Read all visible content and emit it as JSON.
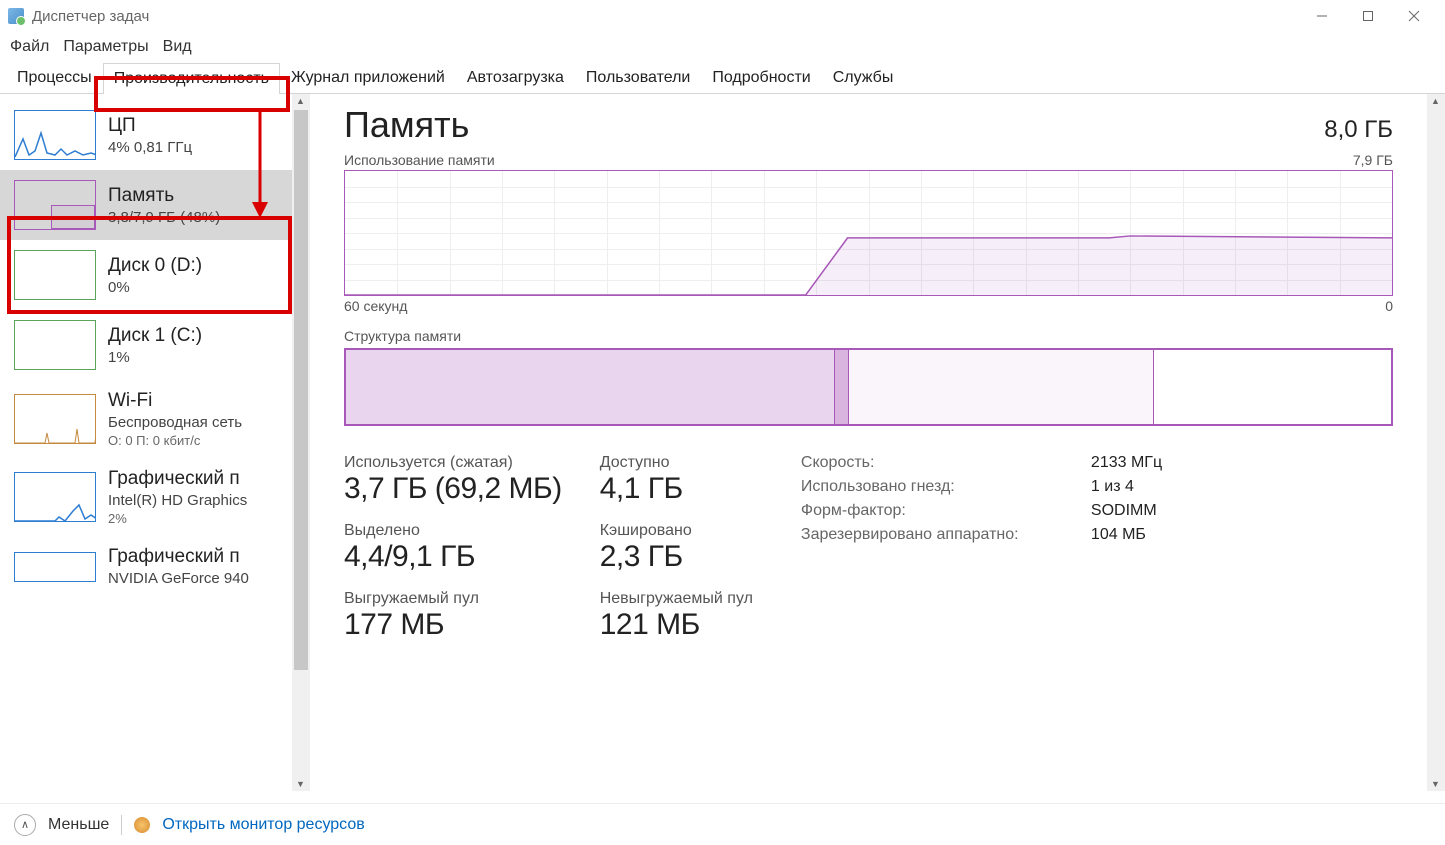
{
  "title": "Диспетчер задач",
  "menu": {
    "file": "Файл",
    "options": "Параметры",
    "view": "Вид"
  },
  "tabs": {
    "processes": "Процессы",
    "performance": "Производительность",
    "app_history": "Журнал приложений",
    "startup": "Автозагрузка",
    "users": "Пользователи",
    "details": "Подробности",
    "services": "Службы"
  },
  "sidebar": {
    "cpu": {
      "title": "ЦП",
      "sub": "4%  0,81 ГГц"
    },
    "memory": {
      "title": "Память",
      "sub": "3,8/7,9 ГБ (48%)"
    },
    "disk0": {
      "title": "Диск 0 (D:)",
      "sub": "0%"
    },
    "disk1": {
      "title": "Диск 1 (C:)",
      "sub": "1%"
    },
    "wifi": {
      "title": "Wi-Fi",
      "sub": "Беспроводная сеть",
      "sub2": "О: 0 П: 0 кбит/с"
    },
    "gpu0": {
      "title": "Графический п",
      "sub": "Intel(R) HD Graphics",
      "sub2": "2%"
    },
    "gpu1": {
      "title": "Графический п",
      "sub": "NVIDIA GeForce 940"
    }
  },
  "main": {
    "title": "Память",
    "capacity": "8,0 ГБ",
    "usage_label": "Использование памяти",
    "usage_max": "7,9 ГБ",
    "axis_left": "60 секунд",
    "axis_right": "0",
    "comp_label": "Структура памяти"
  },
  "stats": {
    "in_use": {
      "label": "Используется (сжатая)",
      "value": "3,7 ГБ (69,2 МБ)"
    },
    "available": {
      "label": "Доступно",
      "value": "4,1 ГБ"
    },
    "committed": {
      "label": "Выделено",
      "value": "4,4/9,1 ГБ"
    },
    "cached": {
      "label": "Кэшировано",
      "value": "2,3 ГБ"
    },
    "paged": {
      "label": "Выгружаемый пул",
      "value": "177 МБ"
    },
    "nonpaged": {
      "label": "Невыгружаемый пул",
      "value": "121 МБ"
    }
  },
  "specs": {
    "speed_k": "Скорость:",
    "speed_v": "2133 МГц",
    "slots_k": "Использовано гнезд:",
    "slots_v": "1 из 4",
    "form_k": "Форм-фактор:",
    "form_v": "SODIMM",
    "reserved_k": "Зарезервировано аппаратно:",
    "reserved_v": "104 МБ"
  },
  "footer": {
    "less": "Меньше",
    "monitor": "Открыть монитор ресурсов"
  },
  "chart_data": {
    "type": "area",
    "title": "Использование памяти",
    "xlabel_left": "60 секунд",
    "xlabel_right": "0",
    "ylabel_max": "7,9 ГБ",
    "ylim": [
      0,
      7.9
    ],
    "x": [
      60,
      55,
      50,
      45,
      40,
      35,
      32,
      30,
      25,
      20,
      15,
      10,
      5,
      0
    ],
    "values": [
      0,
      0,
      0,
      0,
      0,
      0,
      0.2,
      3.6,
      3.6,
      3.6,
      3.65,
      3.6,
      3.6,
      3.6
    ],
    "composition": {
      "type": "bar",
      "title": "Структура памяти",
      "segments": [
        {
          "name": "in_use",
          "value": 3.7
        },
        {
          "name": "modified",
          "value": 0.1
        },
        {
          "name": "standby",
          "value": 2.3
        },
        {
          "name": "free",
          "value": 1.8
        }
      ],
      "total": 7.9
    }
  }
}
